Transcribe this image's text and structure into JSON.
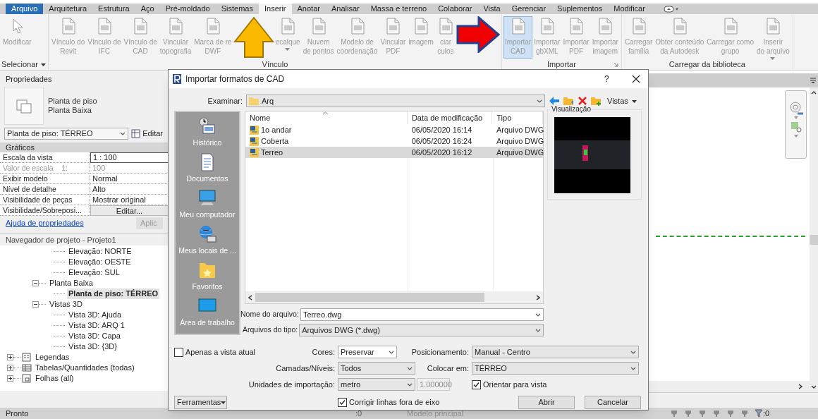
{
  "tabs": [
    {
      "label": "Arquivo",
      "kind": "file",
      "selected": false
    },
    {
      "label": "Arquitetura",
      "kind": "tab",
      "selected": false
    },
    {
      "label": "Estrutura",
      "kind": "tab",
      "selected": false
    },
    {
      "label": "Aço",
      "kind": "tab",
      "selected": false
    },
    {
      "label": "Pré-moldado",
      "kind": "tab",
      "selected": false
    },
    {
      "label": "Sistemas",
      "kind": "tab",
      "selected": false
    },
    {
      "label": "Inserir",
      "kind": "tab",
      "selected": true
    },
    {
      "label": "Anotar",
      "kind": "tab",
      "selected": false
    },
    {
      "label": "Analisar",
      "kind": "tab",
      "selected": false
    },
    {
      "label": "Massa e terreno",
      "kind": "tab",
      "selected": false
    },
    {
      "label": "Colaborar",
      "kind": "tab",
      "selected": false
    },
    {
      "label": "Vista",
      "kind": "tab",
      "selected": false
    },
    {
      "label": "Gerenciar",
      "kind": "tab",
      "selected": false
    },
    {
      "label": "Suplementos",
      "kind": "tab",
      "selected": false
    },
    {
      "label": "Modificar",
      "kind": "tab",
      "selected": false
    }
  ],
  "ribbon": {
    "groups": [
      {
        "label": "Selecionar",
        "dropdown": true,
        "buttons": [
          {
            "lines": [
              "Modificar"
            ],
            "kind": "select",
            "selected": false
          }
        ]
      },
      {
        "label": "Vínculo",
        "dropdown": false,
        "buttons": [
          {
            "lines": [
              "Vínculo do",
              "Revit"
            ],
            "kind": "file",
            "selected": false
          },
          {
            "lines": [
              "Vínculo de",
              "IFC"
            ],
            "kind": "file",
            "selected": false
          },
          {
            "lines": [
              "Vínculo de",
              "CAD"
            ],
            "kind": "file",
            "selected": false
          },
          {
            "lines": [
              "Vincular",
              "topografia"
            ],
            "kind": "file",
            "selected": false
          },
          {
            "lines": [
              "Marca de re",
              "DWF"
            ],
            "kind": "file",
            "selected": false
          },
          {
            "kind": "up_arrow"
          },
          {
            "lines": [
              "ecalque"
            ],
            "kind": "file",
            "selected": false,
            "dropdown": true
          },
          {
            "lines": [
              "Nuvem",
              "de pontos"
            ],
            "kind": "file",
            "selected": false
          },
          {
            "lines": [
              "Modelo de",
              "coordenação"
            ],
            "kind": "file",
            "selected": false
          },
          {
            "lines": [
              "Vincular",
              "PDF"
            ],
            "kind": "file",
            "selected": false
          },
          {
            "lines": [
              "imagem"
            ],
            "kind": "file",
            "selected": false
          },
          {
            "lines": [
              "ciar",
              "culos"
            ],
            "kind": "file",
            "selected": false
          },
          {
            "kind": "right_arrow"
          }
        ]
      },
      {
        "label": "Importar",
        "dropdown": false,
        "launcher": true,
        "buttons": [
          {
            "lines": [
              "Importar",
              "CAD"
            ],
            "kind": "file",
            "selected": true
          },
          {
            "lines": [
              "Importar",
              "gbXML"
            ],
            "kind": "file",
            "selected": false
          },
          {
            "lines": [
              "Importar",
              "PDF"
            ],
            "kind": "file",
            "selected": false
          },
          {
            "lines": [
              "Importar",
              "imagem"
            ],
            "kind": "file",
            "selected": false
          }
        ]
      },
      {
        "label": "Carregar da biblioteca",
        "dropdown": false,
        "buttons": [
          {
            "lines": [
              "Carregar",
              "família"
            ],
            "kind": "file",
            "selected": false
          },
          {
            "lines": [
              "Obter conteúdo",
              "da Autodesk"
            ],
            "kind": "file",
            "selected": false
          },
          {
            "lines": [
              "Carregar como",
              "grupo"
            ],
            "kind": "file",
            "selected": false
          },
          {
            "lines": [
              "Inserir",
              "do arquivo"
            ],
            "kind": "file",
            "selected": false,
            "dropdown": true
          }
        ]
      }
    ]
  },
  "properties": {
    "title": "Propriedades",
    "type_lines": [
      "Planta de piso",
      "Planta Baixa"
    ],
    "instance": "Planta de piso: TÉRREO",
    "edit_type": "Editar",
    "section": "Gráficos",
    "rows": [
      {
        "name": "Escala da vista",
        "value": "1 : 100",
        "kind": "field",
        "disabled": false
      },
      {
        "name": "Valor de escala    1:",
        "value": "100",
        "kind": "text",
        "disabled": true
      },
      {
        "name": "Exibir modelo",
        "value": "Normal",
        "kind": "text",
        "disabled": false
      },
      {
        "name": "Nível de detalhe",
        "value": "Alto",
        "kind": "text",
        "disabled": false
      },
      {
        "name": "Visibilidade de peças",
        "value": "Mostrar original",
        "kind": "text",
        "disabled": false
      },
      {
        "name": "Visibilidade/Sobreposi...",
        "value": "Editar...",
        "kind": "button",
        "disabled": false
      }
    ],
    "help_link": "Ajuda de propriedades",
    "apply": "Aplic"
  },
  "project_browser": {
    "title": "Navegador de projeto - Projeto1",
    "tree": [
      {
        "children": [
          {
            "children": [
              {
                "label": "Elevação: NORTE",
                "selected": false
              },
              {
                "label": "Elevação: OESTE",
                "selected": false
              },
              {
                "label": "Elevação: SUL",
                "selected": false
              }
            ]
          },
          {
            "label": "Planta Baixa",
            "expanded": true,
            "children": [
              {
                "label": "Planta de piso: TÉRREO",
                "selected": true
              }
            ]
          },
          {
            "label": "Vistas 3D",
            "expanded": true,
            "children": [
              {
                "label": "Vista 3D: Ajuda",
                "selected": false
              },
              {
                "label": "Vista 3D: ARQ 1",
                "selected": false
              },
              {
                "label": "Vista 3D: Capa",
                "selected": false
              },
              {
                "label": "Vista 3D: {3D}",
                "selected": false
              }
            ]
          }
        ]
      },
      {
        "label": "Legendas",
        "expanded": false,
        "kind": "legend"
      },
      {
        "label": "Tabelas/Quantidades (todas)",
        "expanded": false,
        "kind": "table"
      },
      {
        "label": "Folhas (all)",
        "expanded": false,
        "kind": "sheet"
      }
    ]
  },
  "dialog": {
    "title": "Importar formatos de CAD",
    "help": "?",
    "look_in_label": "Examinar:",
    "look_in": "Arq",
    "views": "Vistas",
    "places": [
      {
        "label": "Histórico",
        "kind": "history"
      },
      {
        "label": "Documentos",
        "kind": "documents"
      },
      {
        "label": "Meu computador",
        "kind": "computer"
      },
      {
        "label": "Meus locais de ...",
        "kind": "network"
      },
      {
        "label": "Favoritos",
        "kind": "favorites"
      },
      {
        "label": "Área de trabalho",
        "kind": "desktop"
      }
    ],
    "columns": [
      "Nome",
      "Data de modificação",
      "Tipo"
    ],
    "files": [
      {
        "name": "1o andar",
        "date": "06/05/2020 16:14",
        "type": "Arquivo DWG",
        "selected": false
      },
      {
        "name": "Coberta",
        "date": "06/05/2020 16:24",
        "type": "Arquivo DWG",
        "selected": false
      },
      {
        "name": "Terreo",
        "date": "06/05/2020 16:12",
        "type": "Arquivo DWG",
        "selected": true
      }
    ],
    "preview_label": "Visualização",
    "file_name_label": "Nome do arquivo:",
    "file_name": "Terreo.dwg",
    "file_type_label": "Arquivos do tipo:",
    "file_type": "Arquivos DWG  (*.dwg)",
    "current_view_only": {
      "label": "Apenas a vista atual",
      "checked": false
    },
    "colors": {
      "label": "Cores:",
      "value": "Preservar"
    },
    "layers": {
      "label": "Camadas/Níveis:",
      "value": "Todos"
    },
    "units": {
      "label": "Unidades de importação:",
      "value": "metro",
      "factor": "1.000000"
    },
    "positioning": {
      "label": "Posicionamento:",
      "value": "Manual - Centro"
    },
    "place_at": {
      "label": "Colocar em:",
      "value": "TÉRREO"
    },
    "orient_to_view": {
      "label": "Orientar para vista",
      "checked": true
    },
    "correct_lines": {
      "label": "Corrigir linhas fora de eixo",
      "checked": true
    },
    "tools": "Ferramentas",
    "open": "Abrir",
    "cancel": "Cancelar"
  },
  "status_bar": {
    "text": "Pronto",
    "selection_count": ":0",
    "model": "Modelo principal",
    "filter_count": ":0"
  }
}
